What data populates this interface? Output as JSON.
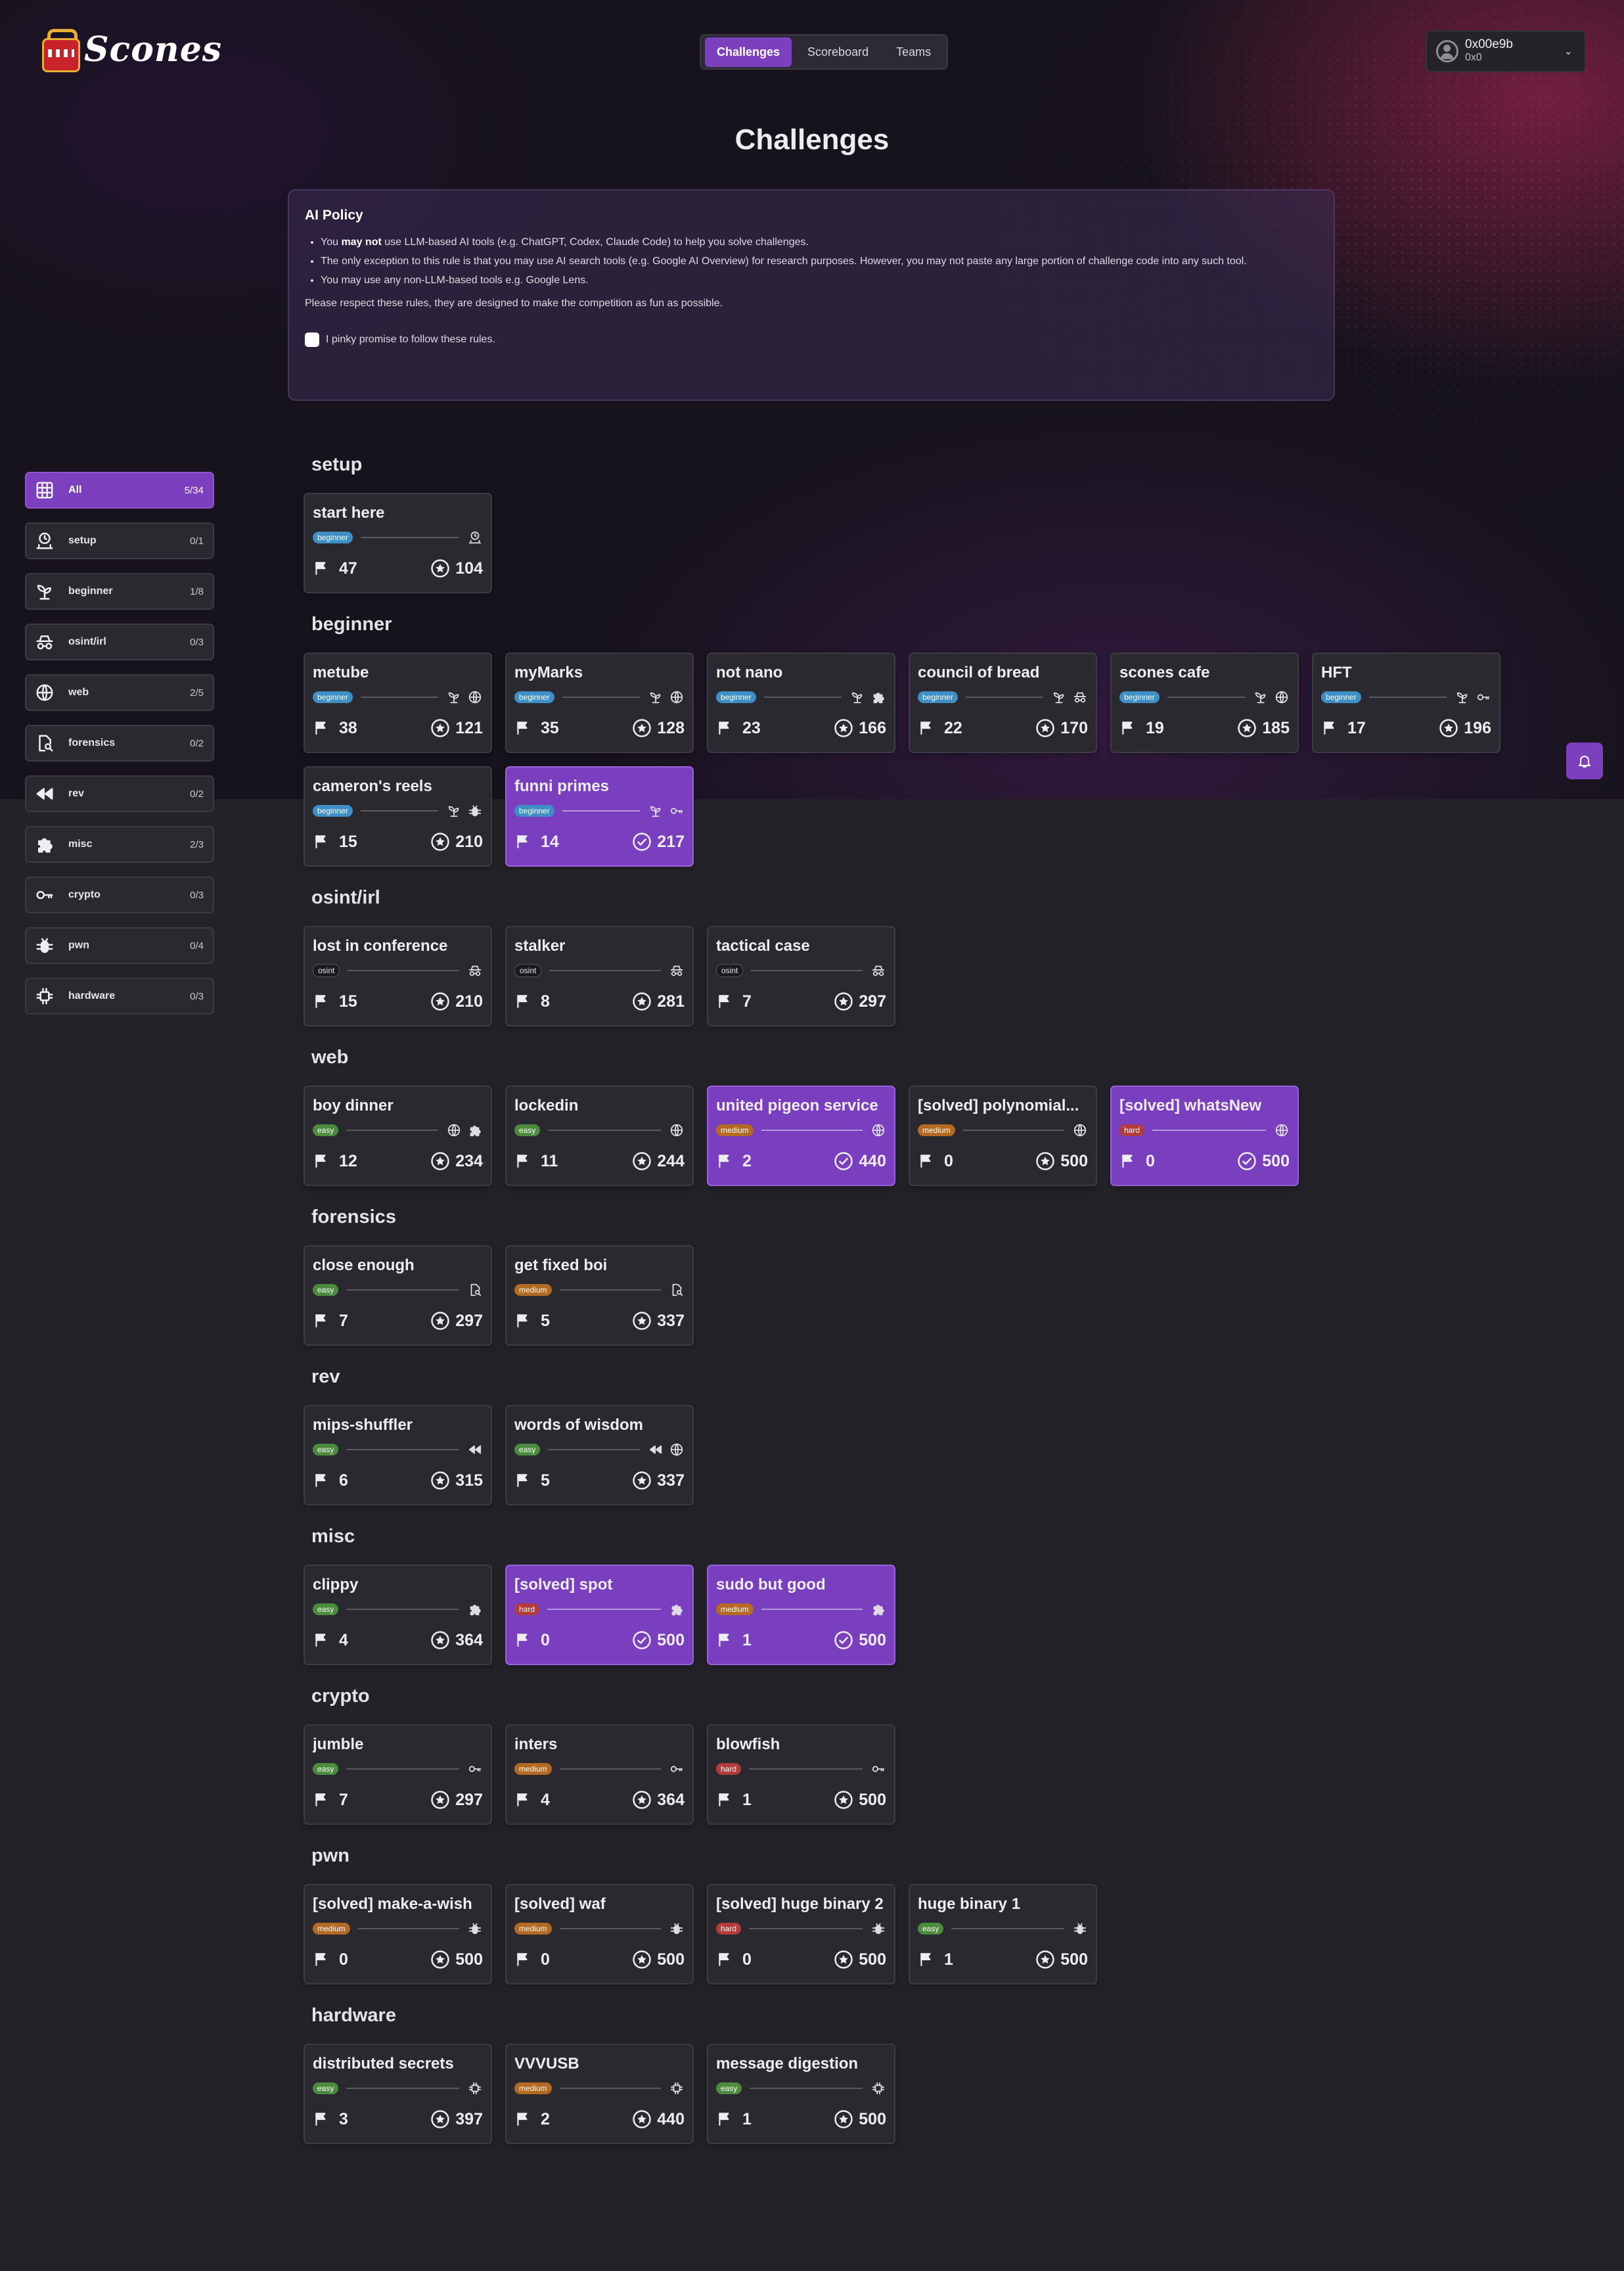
{
  "app": {
    "brand": "Scones"
  },
  "nav": {
    "tabs": [
      "Challenges",
      "Scoreboard",
      "Teams"
    ],
    "active": 0
  },
  "user": {
    "name": "0x00e9b",
    "sub": "0x0"
  },
  "page": {
    "title": "Challenges"
  },
  "policy": {
    "title": "AI Policy",
    "items": [
      {
        "pre": "You ",
        "bold": "may not",
        "post": " use LLM-based AI tools (e.g. ChatGPT, Codex, Claude Code) to help you solve challenges."
      },
      {
        "pre": "The only exception to this rule is that you may use AI search tools (e.g. Google AI Overview) for research purposes. However, you may not paste any large portion of challenge code into any such tool.",
        "bold": "",
        "post": ""
      },
      {
        "pre": "You may use any non-LLM-based tools e.g. Google Lens.",
        "bold": "",
        "post": ""
      }
    ],
    "note": "Please respect these rules, they are designed to make the competition as fun as possible.",
    "checkbox_label": "I pinky promise to follow these rules."
  },
  "sidebar": [
    {
      "label": "All",
      "count": "5/34",
      "icon": "grid-icon",
      "active": true
    },
    {
      "label": "setup",
      "count": "0/1",
      "icon": "setup-icon"
    },
    {
      "label": "beginner",
      "count": "1/8",
      "icon": "sprout-icon"
    },
    {
      "label": "osint/irl",
      "count": "0/3",
      "icon": "spy-icon"
    },
    {
      "label": "web",
      "count": "2/5",
      "icon": "globe-icon"
    },
    {
      "label": "forensics",
      "count": "0/2",
      "icon": "file-search-icon"
    },
    {
      "label": "rev",
      "count": "0/2",
      "icon": "rewind-icon"
    },
    {
      "label": "misc",
      "count": "2/3",
      "icon": "puzzle-icon"
    },
    {
      "label": "crypto",
      "count": "0/3",
      "icon": "key-icon"
    },
    {
      "label": "pwn",
      "count": "0/4",
      "icon": "bug-icon"
    },
    {
      "label": "hardware",
      "count": "0/3",
      "icon": "chip-icon"
    }
  ],
  "sections": [
    {
      "title": "setup",
      "cards": [
        {
          "title": "start here",
          "tag": "beginner",
          "icons": [
            "setup-icon"
          ],
          "solves": "47",
          "points": "104",
          "solved": false
        }
      ]
    },
    {
      "title": "beginner",
      "cards": [
        {
          "title": "metube",
          "tag": "beginner",
          "icons": [
            "sprout-icon",
            "globe-icon"
          ],
          "solves": "38",
          "points": "121",
          "solved": false
        },
        {
          "title": "myMarks",
          "tag": "beginner",
          "icons": [
            "sprout-icon",
            "globe-icon"
          ],
          "solves": "35",
          "points": "128",
          "solved": false
        },
        {
          "title": "not nano",
          "tag": "beginner",
          "icons": [
            "sprout-icon",
            "puzzle-icon"
          ],
          "solves": "23",
          "points": "166",
          "solved": false
        },
        {
          "title": "council of bread",
          "tag": "beginner",
          "icons": [
            "sprout-icon",
            "spy-icon"
          ],
          "solves": "22",
          "points": "170",
          "solved": false
        },
        {
          "title": "scones cafe",
          "tag": "beginner",
          "icons": [
            "sprout-icon",
            "globe-icon"
          ],
          "solves": "19",
          "points": "185",
          "solved": false
        },
        {
          "title": "HFT",
          "tag": "beginner",
          "icons": [
            "sprout-icon",
            "key-icon"
          ],
          "solves": "17",
          "points": "196",
          "solved": false
        },
        {
          "title": "cameron's reels",
          "tag": "beginner",
          "icons": [
            "sprout-icon",
            "bug-icon"
          ],
          "solves": "15",
          "points": "210",
          "solved": false
        },
        {
          "title": "funni primes",
          "tag": "beginner",
          "icons": [
            "sprout-icon",
            "key-icon"
          ],
          "solves": "14",
          "points": "217",
          "solved": true
        }
      ]
    },
    {
      "title": "osint/irl",
      "cards": [
        {
          "title": "lost in conference",
          "tag": "osint",
          "icons": [
            "spy-icon"
          ],
          "solves": "15",
          "points": "210",
          "solved": false
        },
        {
          "title": "stalker",
          "tag": "osint",
          "icons": [
            "spy-icon"
          ],
          "solves": "8",
          "points": "281",
          "solved": false
        },
        {
          "title": "tactical case",
          "tag": "osint",
          "icons": [
            "spy-icon"
          ],
          "solves": "7",
          "points": "297",
          "solved": false
        }
      ]
    },
    {
      "title": "web",
      "cards": [
        {
          "title": "boy dinner",
          "tag": "easy",
          "icons": [
            "globe-icon",
            "puzzle-icon"
          ],
          "solves": "12",
          "points": "234",
          "solved": false
        },
        {
          "title": "lockedin",
          "tag": "easy",
          "icons": [
            "globe-icon"
          ],
          "solves": "11",
          "points": "244",
          "solved": false
        },
        {
          "title": "united pigeon service",
          "tag": "medium",
          "icons": [
            "globe-icon"
          ],
          "solves": "2",
          "points": "440",
          "solved": true
        },
        {
          "title": "[solved] polynomial...",
          "tag": "medium",
          "icons": [
            "globe-icon"
          ],
          "solves": "0",
          "points": "500",
          "solved": false
        },
        {
          "title": "[solved] whatsNew",
          "tag": "hard",
          "icons": [
            "globe-icon"
          ],
          "solves": "0",
          "points": "500",
          "solved": true
        }
      ]
    },
    {
      "title": "forensics",
      "cards": [
        {
          "title": "close enough",
          "tag": "easy",
          "icons": [
            "file-search-icon"
          ],
          "solves": "7",
          "points": "297",
          "solved": false
        },
        {
          "title": "get fixed boi",
          "tag": "medium",
          "icons": [
            "file-search-icon"
          ],
          "solves": "5",
          "points": "337",
          "solved": false
        }
      ]
    },
    {
      "title": "rev",
      "cards": [
        {
          "title": "mips-shuffler",
          "tag": "easy",
          "icons": [
            "rewind-icon"
          ],
          "solves": "6",
          "points": "315",
          "solved": false
        },
        {
          "title": "words of wisdom",
          "tag": "easy",
          "icons": [
            "rewind-icon",
            "globe-icon"
          ],
          "solves": "5",
          "points": "337",
          "solved": false
        }
      ]
    },
    {
      "title": "misc",
      "cards": [
        {
          "title": "clippy",
          "tag": "easy",
          "icons": [
            "puzzle-icon"
          ],
          "solves": "4",
          "points": "364",
          "solved": false
        },
        {
          "title": "[solved] spot",
          "tag": "hard",
          "icons": [
            "puzzle-icon"
          ],
          "solves": "0",
          "points": "500",
          "solved": true
        },
        {
          "title": "sudo but good",
          "tag": "medium",
          "icons": [
            "puzzle-icon"
          ],
          "solves": "1",
          "points": "500",
          "solved": true
        }
      ]
    },
    {
      "title": "crypto",
      "cards": [
        {
          "title": "jumble",
          "tag": "easy",
          "icons": [
            "key-icon"
          ],
          "solves": "7",
          "points": "297",
          "solved": false
        },
        {
          "title": "inters",
          "tag": "medium",
          "icons": [
            "key-icon"
          ],
          "solves": "4",
          "points": "364",
          "solved": false
        },
        {
          "title": "blowfish",
          "tag": "hard",
          "icons": [
            "key-icon"
          ],
          "solves": "1",
          "points": "500",
          "solved": false
        }
      ]
    },
    {
      "title": "pwn",
      "cards": [
        {
          "title": "[solved] make-a-wish",
          "tag": "medium",
          "icons": [
            "bug-icon"
          ],
          "solves": "0",
          "points": "500",
          "solved": false
        },
        {
          "title": "[solved] waf",
          "tag": "medium",
          "icons": [
            "bug-icon"
          ],
          "solves": "0",
          "points": "500",
          "solved": false
        },
        {
          "title": "[solved] huge binary 2",
          "tag": "hard",
          "icons": [
            "bug-icon"
          ],
          "solves": "0",
          "points": "500",
          "solved": false
        },
        {
          "title": "huge binary 1",
          "tag": "easy",
          "icons": [
            "bug-icon"
          ],
          "solves": "1",
          "points": "500",
          "solved": false
        }
      ]
    },
    {
      "title": "hardware",
      "cards": [
        {
          "title": "distributed secrets",
          "tag": "easy",
          "icons": [
            "chip-icon"
          ],
          "solves": "3",
          "points": "397",
          "solved": false
        },
        {
          "title": "VVVUSB",
          "tag": "medium",
          "icons": [
            "chip-icon"
          ],
          "solves": "2",
          "points": "440",
          "solved": false
        },
        {
          "title": "message digestion",
          "tag": "easy",
          "icons": [
            "chip-icon"
          ],
          "solves": "1",
          "points": "500",
          "solved": false
        }
      ]
    }
  ],
  "colors": {
    "accent": "#7c3fbd",
    "beginner": "#3d8fc6",
    "easy": "#4b8b3e",
    "medium": "#b56a22",
    "hard": "#b33b3b"
  }
}
